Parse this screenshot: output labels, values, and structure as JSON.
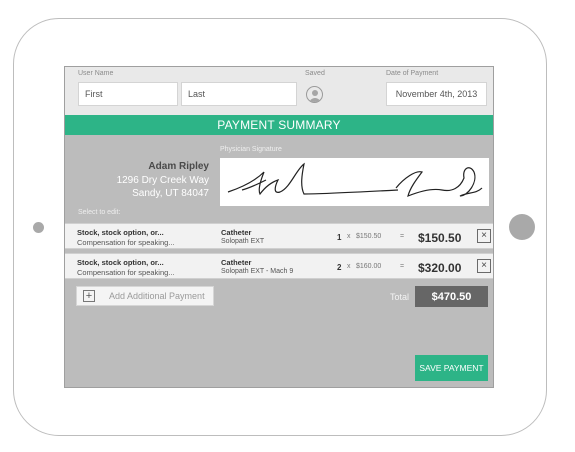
{
  "form": {
    "user_name_label": "User Name",
    "first_placeholder": "First",
    "last_placeholder": "Last",
    "saved_label": "Saved",
    "date_label": "Date of Payment",
    "date_value": "November 4th, 2013"
  },
  "banner": {
    "title": "PAYMENT SUMMARY"
  },
  "payee": {
    "name": "Adam Ripley",
    "address_line1": "1296 Dry Creek Way",
    "address_line2": "Sandy,  UT  84047"
  },
  "signature": {
    "label": "Physician Signature"
  },
  "select_to_edit": "Select to edit:",
  "rows": [
    {
      "description": "Stock, stock option, or...",
      "subdescription": "Compensation for speaking...",
      "product": "Catheter",
      "product_detail": "Solopath EXT",
      "qty": "1",
      "x": "x",
      "unit": "$150.50",
      "eq": "=",
      "total": "$150.50",
      "close": "×"
    },
    {
      "description": "Stock, stock option, or...",
      "subdescription": "Compensation for speaking...",
      "product": "Catheter",
      "product_detail": "Solopath EXT - Mach 9",
      "qty": "2",
      "x": "x",
      "unit": "$160.00",
      "eq": "=",
      "total": "$320.00",
      "close": "×"
    }
  ],
  "add_payment": {
    "icon": "+",
    "label": "Add Additional Payment"
  },
  "totals": {
    "label": "Total",
    "value": "$470.50"
  },
  "save_button": "SAVE PAYMENT",
  "colors": {
    "accent": "#2db487",
    "total_box": "#666666",
    "screen_bg": "#bcbcbc"
  }
}
